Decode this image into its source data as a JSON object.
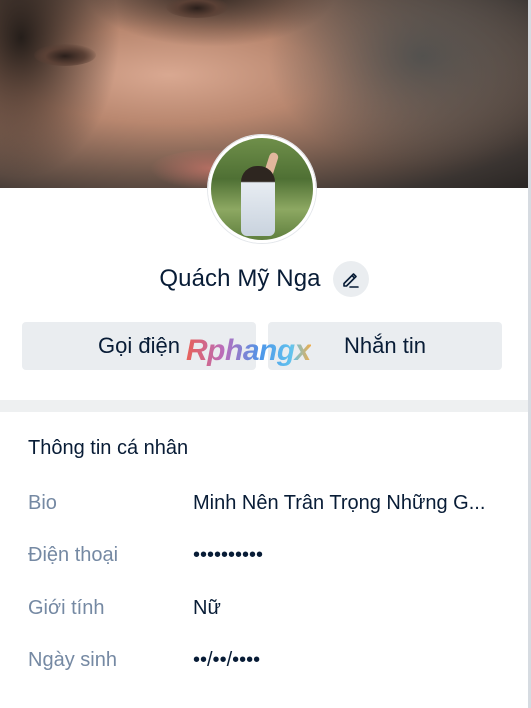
{
  "profile": {
    "name": "Quách Mỹ Nga",
    "actions": {
      "call_label": "Gọi điện",
      "message_label": "Nhắn tin"
    },
    "watermark": "Rphangx"
  },
  "personal_info": {
    "title": "Thông tin cá nhân",
    "rows": [
      {
        "label": "Bio",
        "value": "Minh Nên Trân Trọng Những G..."
      },
      {
        "label": "Điện thoại",
        "value": "••••••••••"
      },
      {
        "label": "Giới tính",
        "value": "Nữ"
      },
      {
        "label": "Ngày sinh",
        "value": "••/••/••••"
      }
    ]
  },
  "icons": {
    "edit": "pencil-icon"
  },
  "colors": {
    "text_primary": "#081c36",
    "text_secondary": "#7589a3",
    "button_bg": "#eaedf0",
    "divider": "#eef0f1"
  }
}
